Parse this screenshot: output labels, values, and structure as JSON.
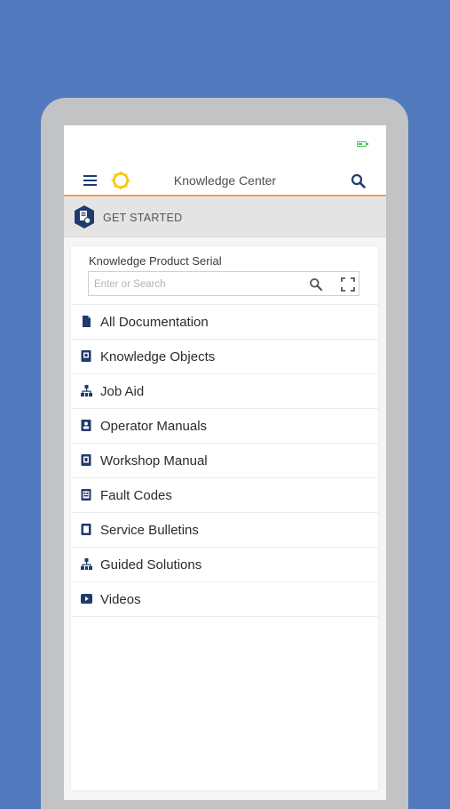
{
  "app": {
    "title": "Knowledge Center"
  },
  "banner": {
    "label": "GET STARTED"
  },
  "serial": {
    "label": "Knowledge Product Serial",
    "placeholder": "Enter or Search",
    "value": ""
  },
  "menu": [
    {
      "label": "All Documentation",
      "icon": "document-icon"
    },
    {
      "label": "Knowledge Objects",
      "icon": "knowledge-object-icon"
    },
    {
      "label": "Job Aid",
      "icon": "hierarchy-icon"
    },
    {
      "label": "Operator Manuals",
      "icon": "operator-manual-icon"
    },
    {
      "label": "Workshop Manual",
      "icon": "workshop-manual-icon"
    },
    {
      "label": "Fault Codes",
      "icon": "fault-code-icon"
    },
    {
      "label": "Service Bulletins",
      "icon": "bulletin-icon"
    },
    {
      "label": "Guided Solutions",
      "icon": "hierarchy-icon"
    },
    {
      "label": "Videos",
      "icon": "video-icon"
    }
  ],
  "colors": {
    "background": "#5179bd",
    "navy": "#1f3b6e",
    "accent_orange": "#f0a04b",
    "logo_yellow": "#f5c518",
    "battery_green": "#3fbf4a"
  }
}
